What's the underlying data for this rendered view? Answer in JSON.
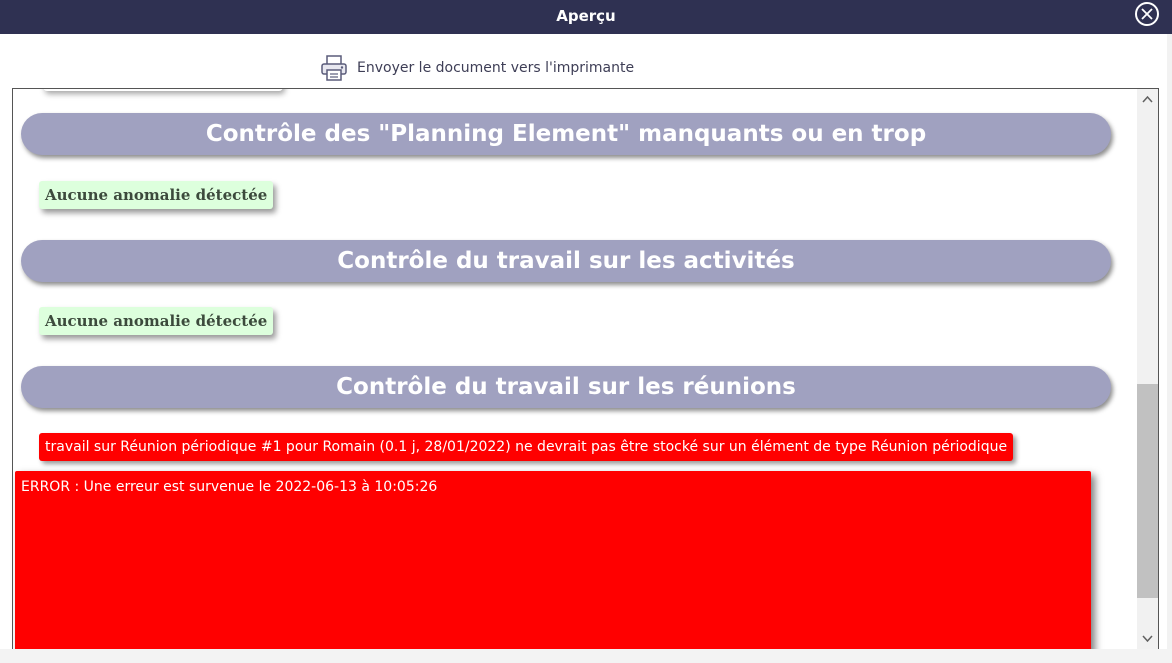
{
  "window": {
    "title": "Aperçu",
    "close_icon": "close-circle-icon"
  },
  "toolbar": {
    "print_label": "Envoyer le document vers l'imprimante",
    "print_icon": "printer-icon"
  },
  "sections": [
    {
      "title": "Contrôle des \"Planning Element\" manquants ou en trop",
      "status": "Aucune anomalie détectée"
    },
    {
      "title": "Contrôle du travail sur les activités",
      "status": "Aucune anomalie détectée"
    },
    {
      "title": "Contrôle du travail sur les réunions",
      "error": "travail sur Réunion périodique #1 pour Romain (0.1 j, 28/01/2022) ne devrait pas être stocké sur un élément de type Réunion périodique"
    }
  ],
  "error_box": {
    "message": "ERROR : Une erreur est survenue le 2022-06-13 à 10:05:26"
  },
  "colors": {
    "titlebar": "#2f3152",
    "section_header": "#a0a1c0",
    "ok_badge_bg": "#ddffdd",
    "error_bg": "#ff0000",
    "scroll_thumb": "#c1c1c1"
  }
}
